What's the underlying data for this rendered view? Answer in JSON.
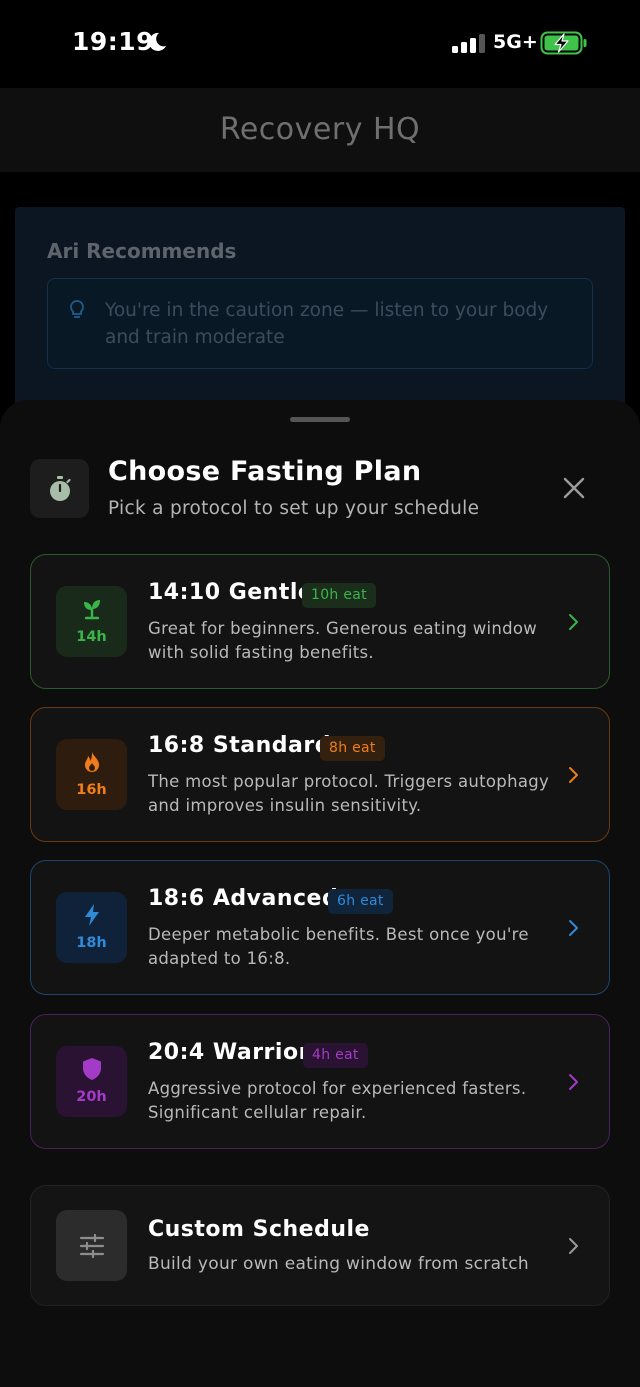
{
  "status_bar": {
    "time": "19:19",
    "network": "5G+",
    "icons": [
      "moon-icon",
      "signal-icon",
      "battery-charging-icon"
    ]
  },
  "header": {
    "title": "Recovery HQ"
  },
  "recommendation": {
    "title": "Ari Recommends",
    "icon": "lightbulb-icon",
    "message": "You're in the caution zone — listen to your body and train moderate"
  },
  "sheet": {
    "icon": "stopwatch-icon",
    "title": "Choose Fasting Plan",
    "subtitle": "Pick a protocol to set up your schedule",
    "close_icon": "close-icon",
    "plans": [
      {
        "name": "14:10 Gentle",
        "badge": "10h eat",
        "hours": "14h",
        "description": "Great for beginners. Generous eating window with solid fasting benefits.",
        "icon": "sprout-icon",
        "accent": "#3ab54a",
        "border": "#2c5a2a",
        "icon_bg": "#1a2a1a",
        "badge_bg": "#1b2e1b"
      },
      {
        "name": "16:8 Standard",
        "badge": "8h eat",
        "hours": "16h",
        "description": "The most popular protocol. Triggers autophagy and improves insulin sensitivity.",
        "icon": "flame-icon",
        "accent": "#f07d1a",
        "border": "#6b3a10",
        "icon_bg": "#2e1d0f",
        "badge_bg": "#33200e"
      },
      {
        "name": "18:6 Advanced",
        "badge": "6h eat",
        "hours": "18h",
        "description": "Deeper metabolic benefits. Best once you're adapted to 16:8.",
        "icon": "lightning-icon",
        "accent": "#2f8ad8",
        "border": "#1c4670",
        "icon_bg": "#10223a",
        "badge_bg": "#10243b"
      },
      {
        "name": "20:4 Warrior",
        "badge": "4h eat",
        "hours": "20h",
        "description": "Aggressive protocol for experienced fasters. Significant cellular repair.",
        "icon": "shield-icon",
        "accent": "#a43bc7",
        "border": "#4e1f5e",
        "icon_bg": "#2a1233",
        "badge_bg": "#2a1232"
      }
    ],
    "custom": {
      "title": "Custom Schedule",
      "description": "Build your own eating window from scratch",
      "icon": "sliders-icon"
    }
  }
}
